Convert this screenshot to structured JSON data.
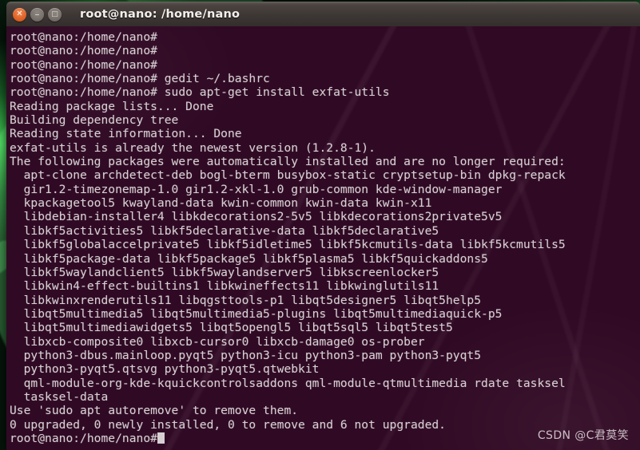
{
  "window": {
    "title": "root@nano: /home/nano",
    "buttons": [
      {
        "name": "close-button",
        "glyph": "✕"
      },
      {
        "name": "minimize-button",
        "glyph": "–"
      },
      {
        "name": "maximize-button",
        "glyph": "□"
      }
    ]
  },
  "theme": {
    "terminal_bg": "#300a24",
    "terminal_fg": "#d6cfd2",
    "titlebar_bg": "#3d3734",
    "close_button": "#e2642a",
    "desktop_accent": "#46dc5a"
  },
  "terminal": {
    "prompt": "root@nano:/home/nano#",
    "lines": [
      "root@nano:/home/nano#",
      "root@nano:/home/nano#",
      "root@nano:/home/nano#",
      "root@nano:/home/nano# gedit ~/.bashrc",
      "root@nano:/home/nano# sudo apt-get install exfat-utils",
      "Reading package lists... Done",
      "Building dependency tree",
      "Reading state information... Done",
      "exfat-utils is already the newest version (1.2.8-1).",
      "The following packages were automatically installed and are no longer required:",
      "  apt-clone archdetect-deb bogl-bterm busybox-static cryptsetup-bin dpkg-repack",
      "  gir1.2-timezonemap-1.0 gir1.2-xkl-1.0 grub-common kde-window-manager",
      "  kpackagetool5 kwayland-data kwin-common kwin-data kwin-x11",
      "  libdebian-installer4 libkdecorations2-5v5 libkdecorations2private5v5",
      "  libkf5activities5 libkf5declarative-data libkf5declarative5",
      "  libkf5globalaccelprivate5 libkf5idletime5 libkf5kcmutils-data libkf5kcmutils5",
      "  libkf5package-data libkf5package5 libkf5plasma5 libkf5quickaddons5",
      "  libkf5waylandclient5 libkf5waylandserver5 libkscreenlocker5",
      "  libkwin4-effect-builtins1 libkwineffects11 libkwinglutils11",
      "  libkwinxrenderutils11 libqgsttools-p1 libqt5designer5 libqt5help5",
      "  libqt5multimedia5 libqt5multimedia5-plugins libqt5multimediaquick-p5",
      "  libqt5multimediawidgets5 libqt5opengl5 libqt5sql5 libqt5test5",
      "  libxcb-composite0 libxcb-cursor0 libxcb-damage0 os-prober",
      "  python3-dbus.mainloop.pyqt5 python3-icu python3-pam python3-pyqt5",
      "  python3-pyqt5.qtsvg python3-pyqt5.qtwebkit",
      "  qml-module-org-kde-kquickcontrolsaddons qml-module-qtmultimedia rdate tasksel",
      "  tasksel-data",
      "Use 'sudo apt autoremove' to remove them.",
      "0 upgraded, 0 newly installed, 0 to remove and 6 not upgraded.",
      "root@nano:/home/nano#"
    ]
  },
  "watermark": {
    "text": "CSDN @C君莫笑"
  }
}
